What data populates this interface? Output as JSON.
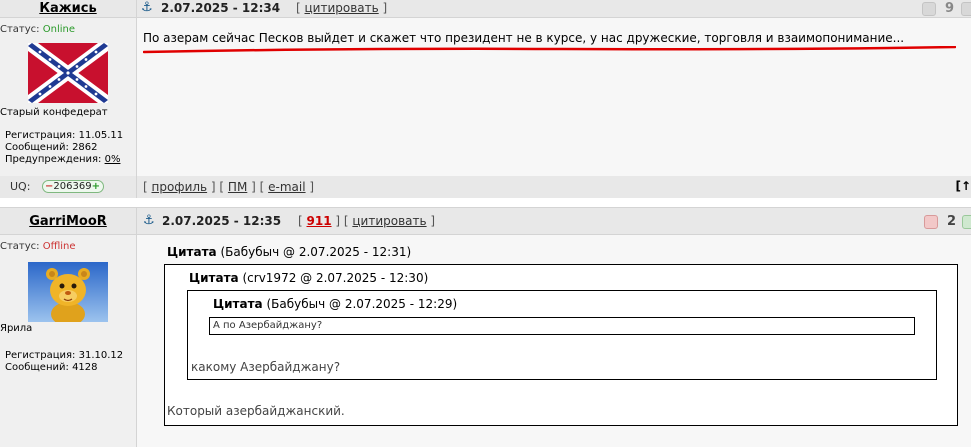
{
  "posts": [
    {
      "username": "Кажись",
      "status_label": "Статус:",
      "status_value": "Online",
      "rank": "Старый конфедерат",
      "avatar": "confederate-flag",
      "date": "2.07.2025 - 12:34",
      "quote_link": "цитировать",
      "vote_count": "9",
      "stats": {
        "reg_label": "Регистрация:",
        "reg_value": "11.05.11",
        "msgs_label": "Сообщений:",
        "msgs_value": "2862",
        "warn_label": "Предупреждения:",
        "warn_value": "0%"
      },
      "message": "По азерам сейчас Песков выйдет и скажет что президент не в курсе, у нас дружеские, торговля и взаимопонимание...",
      "footer": {
        "uq_label": "UQ:",
        "uq_minus": "−",
        "uq_value": "206369",
        "uq_plus": "+",
        "profile": "профиль",
        "pm": "ПМ",
        "email": "e-mail"
      }
    },
    {
      "username": "GarriMooR",
      "status_label": "Статус:",
      "status_value": "Offline",
      "rank": "Ярила",
      "avatar": "yellow-cartoon-bear",
      "date": "2.07.2025 - 12:35",
      "post_number": "911",
      "quote_link": "цитировать",
      "vote_count": "2",
      "stats": {
        "reg_label": "Регистрация:",
        "reg_value": "31.10.12",
        "msgs_label": "Сообщений:",
        "msgs_value": "4128"
      },
      "quote1": {
        "label": "Цитата",
        "meta": "(Бабубыч @ 2.07.2025 - 12:31)"
      },
      "quote2": {
        "label": "Цитата",
        "meta": "(crv1972 @ 2.07.2025 - 12:30)"
      },
      "quote3": {
        "label": "Цитата",
        "meta": "(Бабубыч @ 2.07.2025 - 12:29)",
        "text": "А по Азербайджану?"
      },
      "quote2_text": "какому Азербайджану?",
      "reply": "Который азербайджанский."
    }
  ],
  "colors": {
    "online": "#2a9a2a",
    "offline": "#cc3333",
    "post_link": "#cc0000",
    "underline": "#e00000"
  }
}
